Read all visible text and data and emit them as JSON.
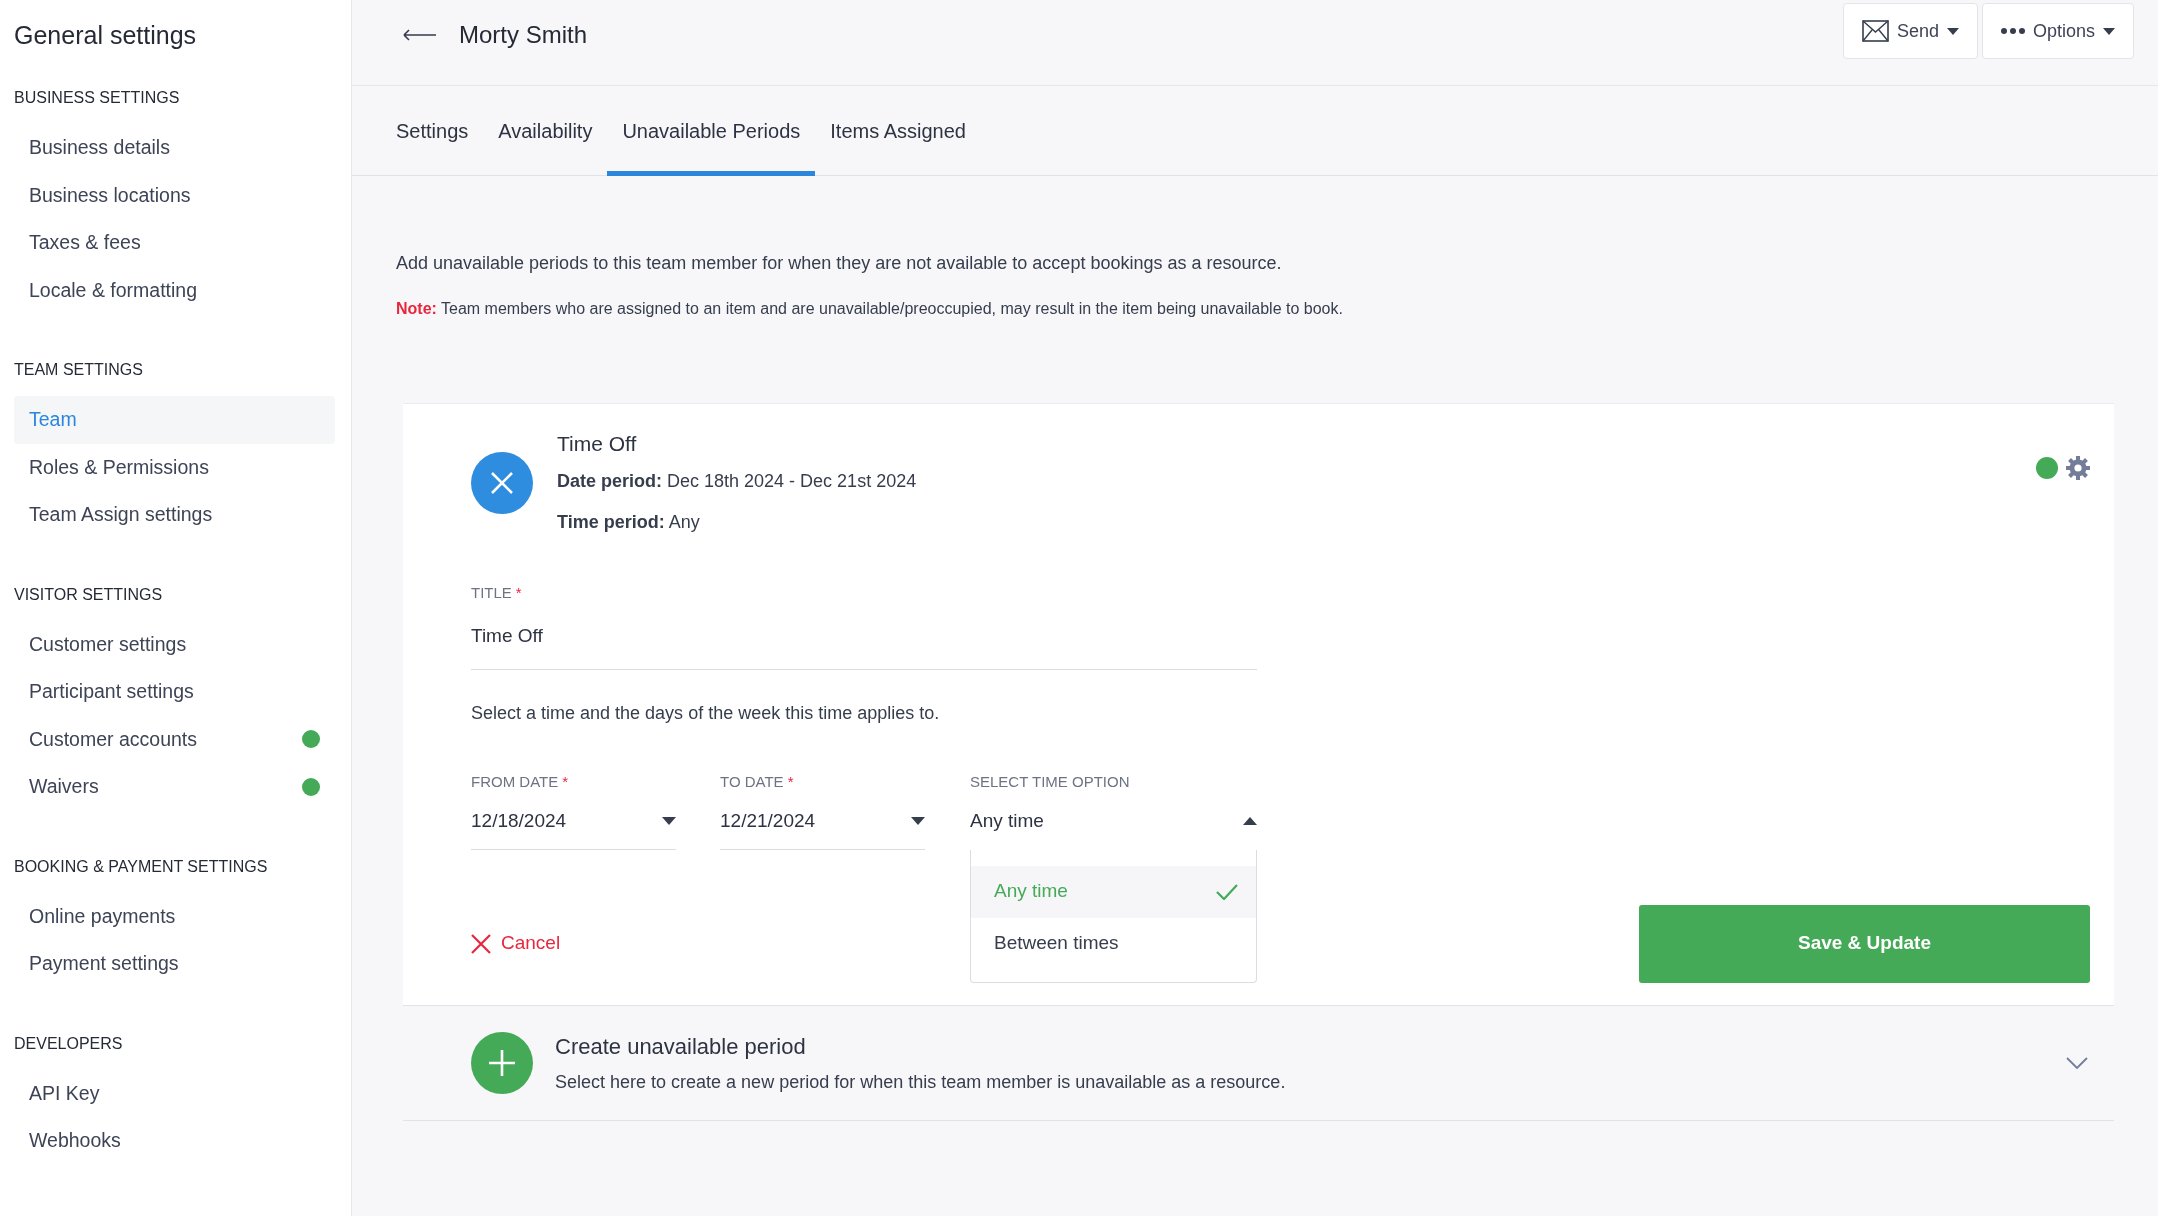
{
  "sidebar": {
    "title": "General settings",
    "sections": [
      {
        "heading": "BUSINESS SETTINGS",
        "items": [
          {
            "label": "Business details",
            "selected": false,
            "status_dot": false
          },
          {
            "label": "Business locations",
            "selected": false,
            "status_dot": false
          },
          {
            "label": "Taxes & fees",
            "selected": false,
            "status_dot": false
          },
          {
            "label": "Locale & formatting",
            "selected": false,
            "status_dot": false
          }
        ]
      },
      {
        "heading": "TEAM SETTINGS",
        "items": [
          {
            "label": "Team",
            "selected": true,
            "status_dot": false
          },
          {
            "label": "Roles & Permissions",
            "selected": false,
            "status_dot": false
          },
          {
            "label": "Team Assign settings",
            "selected": false,
            "status_dot": false
          }
        ]
      },
      {
        "heading": "VISITOR SETTINGS",
        "items": [
          {
            "label": "Customer settings",
            "selected": false,
            "status_dot": false
          },
          {
            "label": "Participant settings",
            "selected": false,
            "status_dot": false
          },
          {
            "label": "Customer accounts",
            "selected": false,
            "status_dot": true
          },
          {
            "label": "Waivers",
            "selected": false,
            "status_dot": true
          }
        ]
      },
      {
        "heading": "BOOKING & PAYMENT SETTINGS",
        "items": [
          {
            "label": "Online payments",
            "selected": false,
            "status_dot": false
          },
          {
            "label": "Payment settings",
            "selected": false,
            "status_dot": false
          }
        ]
      },
      {
        "heading": "DEVELOPERS",
        "items": [
          {
            "label": "API Key",
            "selected": false,
            "status_dot": false
          },
          {
            "label": "Webhooks",
            "selected": false,
            "status_dot": false
          }
        ]
      }
    ]
  },
  "header": {
    "title": "Morty Smith",
    "buttons": [
      {
        "kind": "send",
        "label": "Send"
      },
      {
        "kind": "options",
        "label": "Options"
      }
    ]
  },
  "tabs": [
    {
      "label": "Settings",
      "selected": false
    },
    {
      "label": "Availability",
      "selected": false
    },
    {
      "label": "Unavailable Periods",
      "selected": true
    },
    {
      "label": "Items Assigned",
      "selected": false
    }
  ],
  "intro": "Add unavailable periods to this team member for when they are not available to accept bookings as a resource.",
  "note": "**Note:** Team members who are assigned to an item and are unavailable/preoccupied, may result in the item being unavailable to book.",
  "period": {
    "title": "Time Off",
    "details": [
      "**Date period:** Dec 18th 2024 - Dec 21st 2024",
      "**Time period:** Any"
    ],
    "active": true,
    "form": {
      "title_field": {
        "label": "TITLE",
        "required_mark": "*",
        "value": "Time Off"
      },
      "hint": "Select a time and the days of the week this time applies to.",
      "fields": [
        {
          "label": "FROM DATE",
          "required_mark": "*",
          "value": "12/18/2024",
          "expanded": false
        },
        {
          "label": "TO DATE",
          "required_mark": "*",
          "value": "12/21/2024",
          "expanded": false
        },
        {
          "label": "SELECT TIME OPTION",
          "value": "Any time",
          "expanded": true
        }
      ],
      "time_options": [
        {
          "label": "Any time",
          "selected": true
        },
        {
          "label": "Between times",
          "selected": false
        }
      ],
      "cancel": "Cancel",
      "save": "Save & Update"
    }
  },
  "create": {
    "title": "Create unavailable period",
    "subtitle": "Select here to create a new period for when this team member is unavailable as a resource.",
    "expanded": false
  }
}
